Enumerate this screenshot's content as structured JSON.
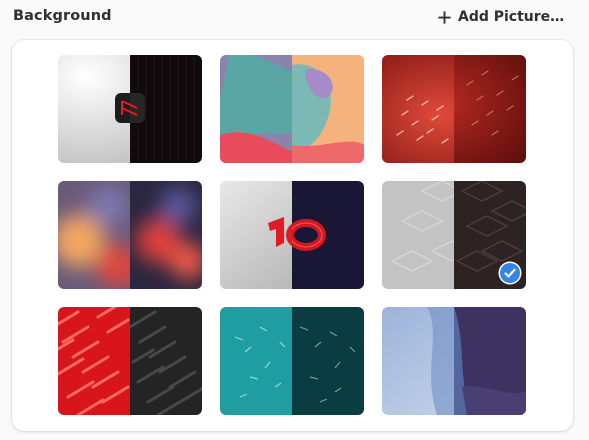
{
  "section": {
    "title": "Background"
  },
  "add_button": {
    "label": "Add Picture…",
    "icon": "plus-icon"
  },
  "accent_color": "#3584e4",
  "backgrounds": [
    {
      "name": "amber-logo",
      "selected": false
    },
    {
      "name": "fluid-blobs",
      "selected": false
    },
    {
      "name": "red-texture",
      "selected": false
    },
    {
      "name": "blurred-lights",
      "selected": false
    },
    {
      "name": "red-ten",
      "selected": false
    },
    {
      "name": "diamond-pattern",
      "selected": true
    },
    {
      "name": "red-shingles",
      "selected": false
    },
    {
      "name": "teal-waves",
      "selected": false
    },
    {
      "name": "blue-wave",
      "selected": false
    }
  ]
}
